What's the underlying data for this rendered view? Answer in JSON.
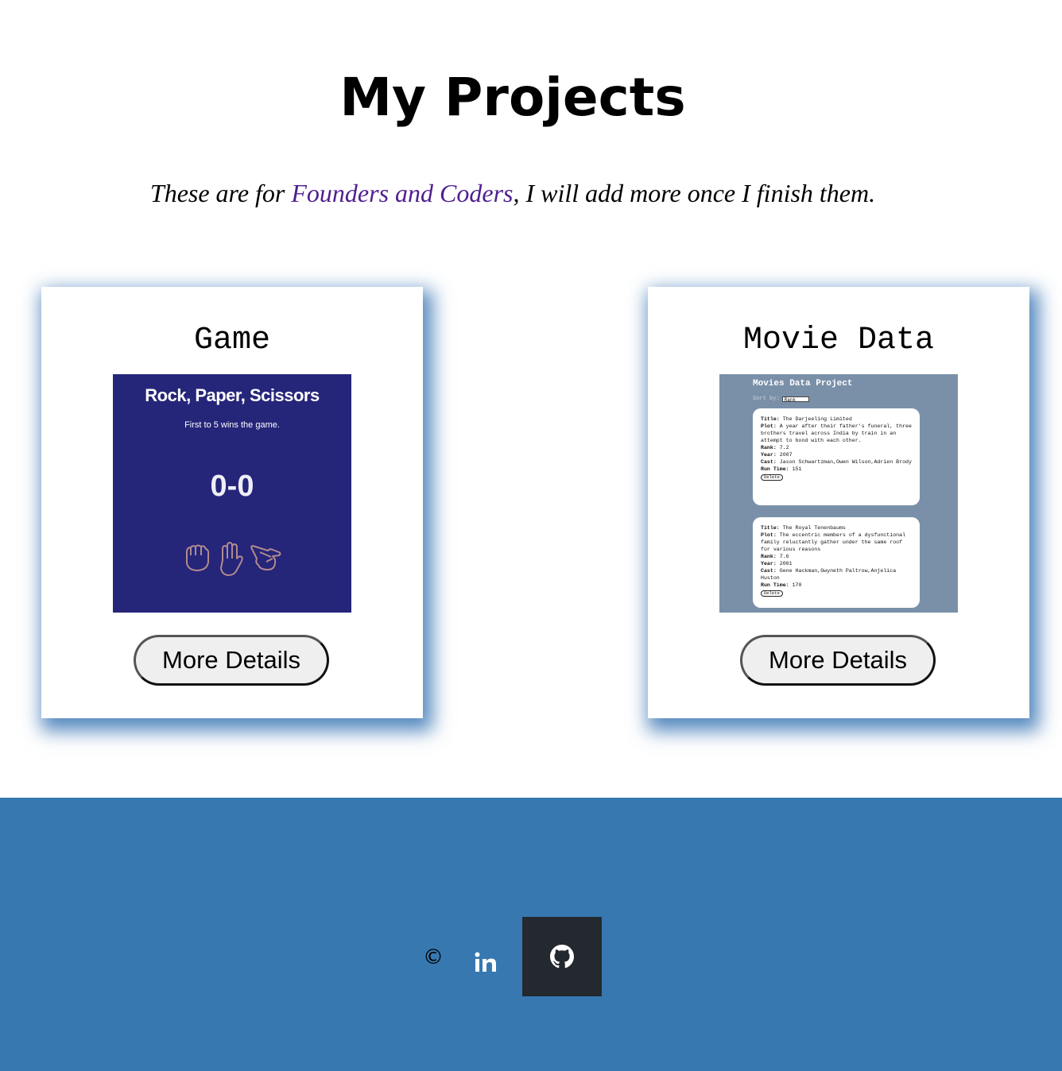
{
  "header": {
    "title": "My Projects",
    "intro_before": "These are for ",
    "intro_link": "Founders and Coders",
    "intro_after": ", I will add more once I finish them."
  },
  "projects": [
    {
      "title": "Game",
      "button_label": "More Details",
      "thumbnail": {
        "heading": "Rock, Paper, Scissors",
        "subheading": "First to 5 wins the game.",
        "score": "0-0",
        "icons": [
          "rock-hand-icon",
          "paper-hand-icon",
          "scissors-hand-icon"
        ]
      }
    },
    {
      "title": "Movie Data",
      "button_label": "More Details",
      "thumbnail": {
        "heading": "Movies Data Project",
        "sort_label": "Sort by:",
        "sort_value": "Rank",
        "movies": [
          {
            "title_label": "Title:",
            "title": "The Darjeeling Limited",
            "plot_label": "Plot:",
            "plot": "A year after their father's funeral, three brothers travel across India by train in an attempt to bond with each other.",
            "rank_label": "Rank:",
            "rank": "7.2",
            "year_label": "Year:",
            "year": "2007",
            "cast_label": "Cast:",
            "cast": "Jason Schwartzman,Owen Wilson,Adrien Brody",
            "runtime_label": "Run Time:",
            "runtime": "151",
            "delete_label": "Delete"
          },
          {
            "title_label": "Title:",
            "title": "The Royal Tenenbaums",
            "plot_label": "Plot:",
            "plot": "The eccentric members of a dysfunctional family reluctantly gather under the same roof for various reasons",
            "rank_label": "Rank:",
            "rank": "7.6",
            "year_label": "Year:",
            "year": "2001",
            "cast_label": "Cast:",
            "cast": "Gene Hackman,Gwyneth Paltrow,Anjelica Huston",
            "runtime_label": "Run Time:",
            "runtime": "170",
            "delete_label": "Delete"
          }
        ]
      }
    }
  ],
  "footer": {
    "copyright": "©",
    "icons": [
      "linkedin-icon",
      "github-icon"
    ],
    "colors": {
      "background": "#3778b1",
      "github_box": "#24292f"
    }
  },
  "colors": {
    "card_shadow": "#3874b4",
    "link": "#4f1f8f",
    "game_bg": "#25257a",
    "movie_bg": "#7a90a8"
  }
}
